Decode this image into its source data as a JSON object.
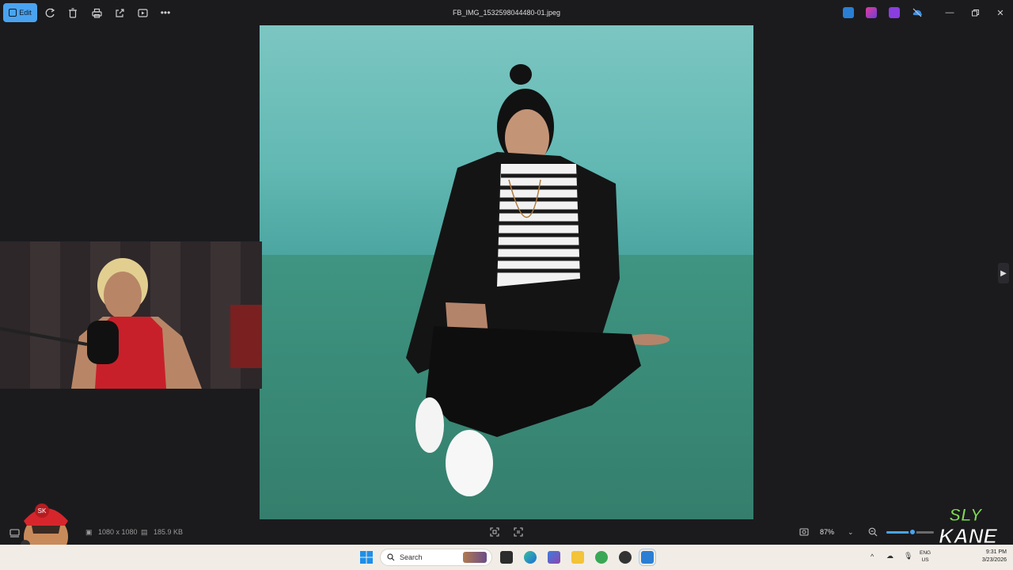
{
  "toolbar": {
    "edit_label": "Edit",
    "file_name": "FB_IMG_1532598044480-01.jpeg"
  },
  "status": {
    "dimensions": "1080 x 1080",
    "file_size": "185.9 KB",
    "zoom": "87%",
    "zoom_fraction": 0.55
  },
  "taskbar": {
    "search_placeholder": "Search",
    "lang_top": "ENG",
    "lang_bottom": "US",
    "time": "9:31 PM",
    "date": "3/23/2026"
  },
  "overlay": {
    "logo_text": "SLY KANE",
    "avatar_badge": "SK"
  },
  "colors": {
    "accent": "#4aa3f0",
    "wall": "#62b8b3",
    "floor": "#3a8c79"
  }
}
